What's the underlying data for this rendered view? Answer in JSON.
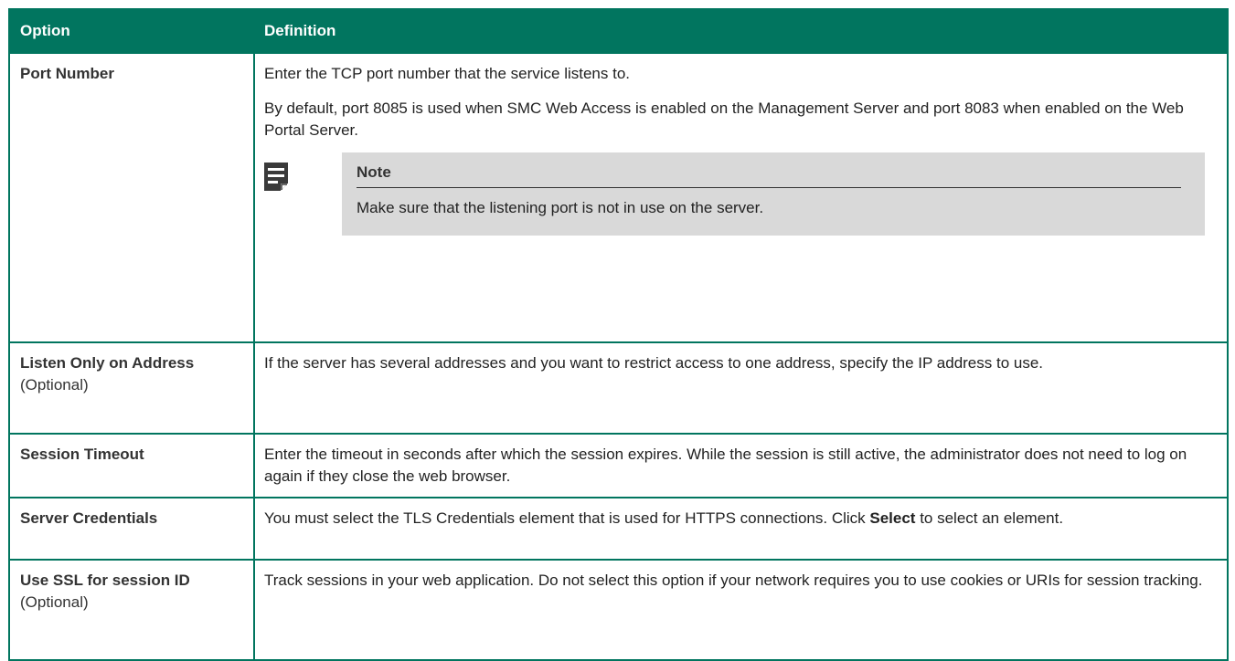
{
  "table": {
    "headers": {
      "option": "Option",
      "definition": "Definition"
    },
    "rows": [
      {
        "option": "Port Number",
        "option_sub": "",
        "p1": "Enter the TCP port number that the service listens to.",
        "p2": "By default, port 8085 is used when SMC Web Access is enabled on the Management Server and port 8083 when enabled on the Web Portal Server.",
        "note": {
          "icon": "note-icon",
          "title": "Note",
          "text": "Make sure that the listening port is not in use on the server."
        }
      },
      {
        "option": "Listen Only on Address",
        "option_sub": "(Optional)",
        "p1": "If the server has several addresses and you want to restrict access to one address, specify the IP address to use."
      },
      {
        "option": "Session Timeout",
        "option_sub": "",
        "p1": "Enter the timeout in seconds after which the session expires. While the session is still active, the administrator does not need to log on again if they close the web browser."
      },
      {
        "option": "Server Credentials",
        "option_sub": "",
        "p1_before": "You must select the TLS Credentials element that is used for HTTPS connections. Click ",
        "p1_bold": "Select",
        "p1_after": " to select an element."
      },
      {
        "option": "Use SSL for session ID",
        "option_sub": "(Optional)",
        "p1": "Track sessions in your web application. Do not select this option if your network requires you to use cookies or URIs for session tracking."
      }
    ]
  },
  "colors": {
    "header_bg": "#01755f",
    "header_text": "#ffffff",
    "note_bg": "#d9d9d9",
    "border": "#01755f"
  }
}
